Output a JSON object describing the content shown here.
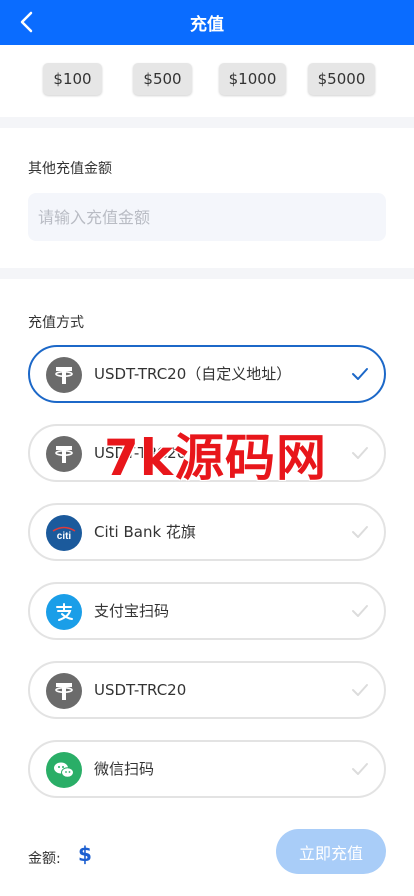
{
  "header": {
    "title": "充值"
  },
  "quick_amounts": [
    "$100",
    "$500",
    "$1000",
    "$5000"
  ],
  "custom_amount": {
    "label": "其他充值金额",
    "placeholder": "请输入充值金额"
  },
  "methods": {
    "label": "充值方式",
    "items": [
      {
        "label": "USDT-TRC20（自定义地址）",
        "icon": "tether-icon",
        "selected": true
      },
      {
        "label": "USDT-TRC20",
        "icon": "tether-icon",
        "selected": false
      },
      {
        "label": "Citi Bank 花旗",
        "icon": "citi-icon",
        "selected": false
      },
      {
        "label": "支付宝扫码",
        "icon": "alipay-icon",
        "selected": false
      },
      {
        "label": "USDT-TRC20",
        "icon": "tether-icon",
        "selected": false
      },
      {
        "label": "微信扫码",
        "icon": "wechat-icon",
        "selected": false
      }
    ]
  },
  "footer": {
    "amount_label": "金额:",
    "currency": "$",
    "submit_label": "立即充值"
  },
  "watermark": "7k源码网",
  "colors": {
    "header": "#0a6cff",
    "selected_border": "#1c68c8",
    "submit_bg": "#a9cdf8",
    "watermark": "#e8161b",
    "alipay": "#1a9ee8",
    "wechat": "#2aae67",
    "citi": "#1b5a9c",
    "tether": "#6b6b6b"
  }
}
